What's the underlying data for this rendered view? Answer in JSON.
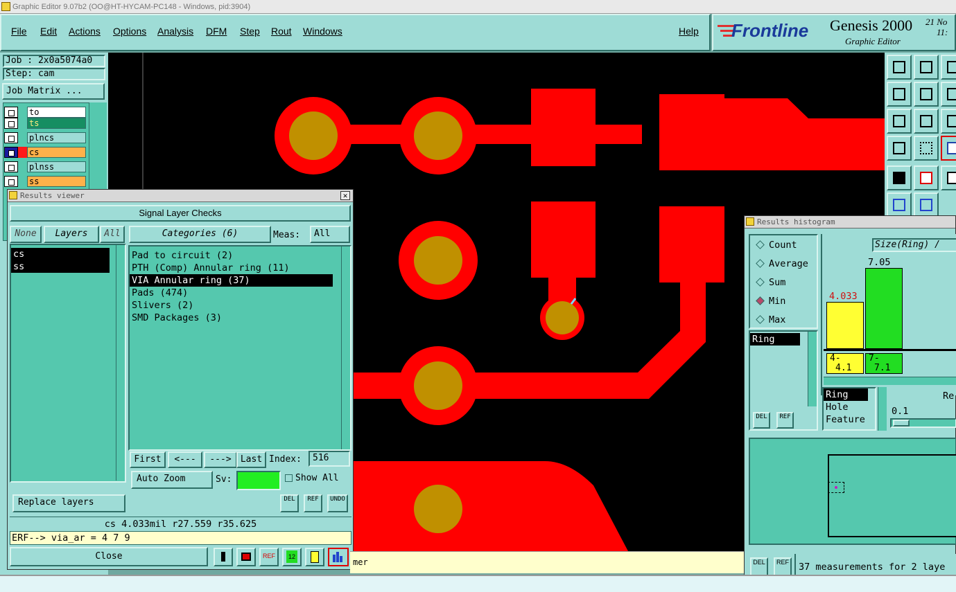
{
  "window": {
    "title": "Graphic Editor 9.07b2 (OO@HT-HYCAM-PC148 - Windows, pid:3904)"
  },
  "menu": [
    "File",
    "Edit",
    "Actions",
    "Options",
    "Analysis",
    "DFM",
    "Step",
    "Rout",
    "Windows"
  ],
  "help": "Help",
  "logo": {
    "brand": "Frontline",
    "product": "Genesis 2000",
    "subtitle": "Graphic Editor",
    "date": "21 No",
    "time": "11:"
  },
  "left": {
    "job": "Job : 2x0a5074a0",
    "step": "Step: cam",
    "job_matrix": "Job Matrix ...",
    "layers": [
      {
        "name": "to",
        "color": "#ffffff"
      },
      {
        "name": "ts",
        "color": "#168e62"
      },
      {
        "name": "plncs",
        "color": "#9edcd6"
      },
      {
        "name": "cs",
        "color": "#ffb14a"
      },
      {
        "name": "plnss",
        "color": "#9edcd6"
      },
      {
        "name": "ss",
        "color": "#ffb14a"
      }
    ]
  },
  "results_viewer": {
    "title": "Results viewer",
    "header": "Signal Layer Checks",
    "none": "None",
    "layers_label": "Layers",
    "all": "All",
    "layers": [
      "cs",
      "ss"
    ],
    "categories_label": "Categories (6)",
    "meas_label": "Meas:",
    "meas_value": "All",
    "categories": [
      "Pad to circuit (2)",
      "PTH (Comp) Annular ring (11)",
      "VIA Annular ring (37)",
      "Pads (474)",
      "Slivers (2)",
      "SMD Packages (3)"
    ],
    "selected_category": 2,
    "first": "First",
    "prev": "<---",
    "next": "--->",
    "last": "Last",
    "index_label": "Index:",
    "index_value": "516",
    "auto_zoom": "Auto Zoom",
    "sv_label": "Sv:",
    "show_all": "Show All",
    "replace_layers": "Replace layers",
    "del": "DEL",
    "ref": "REF",
    "undo": "UNDO",
    "info": "cs 4.033mil  r27.559  r35.625",
    "erf": "ERF--> via_ar = 4 7 9",
    "close": "Close",
    "refbtn": "REF",
    "nums": "12"
  },
  "histogram": {
    "title": "Results histogram",
    "modes": [
      "Count",
      "Average",
      "Sum",
      "Min",
      "Max"
    ],
    "selected_mode": "Min",
    "field_list": [
      "Ring"
    ],
    "size_label": "Size(Ring) / ",
    "bars": [
      {
        "value": "4.033",
        "range_top": "4-",
        "range_bottom": "4.1",
        "color": "#ffff33",
        "height": 0.52
      },
      {
        "value": "7.05",
        "range_top": "7-",
        "range_bottom": "7.1",
        "color": "#22dd22",
        "height": 0.9
      }
    ],
    "attrs": [
      "Ring",
      "Hole",
      "Feature"
    ],
    "res_label": "Re",
    "res_value": "0.1",
    "del": "DEL",
    "ref": "REF",
    "summary": "37 measurements for 2 laye"
  },
  "bottom_text": "mer",
  "colors": {
    "panel": "#9edcd6",
    "teal": "#55c8ae",
    "copper": "#ff0000",
    "drill": "#c09000"
  }
}
